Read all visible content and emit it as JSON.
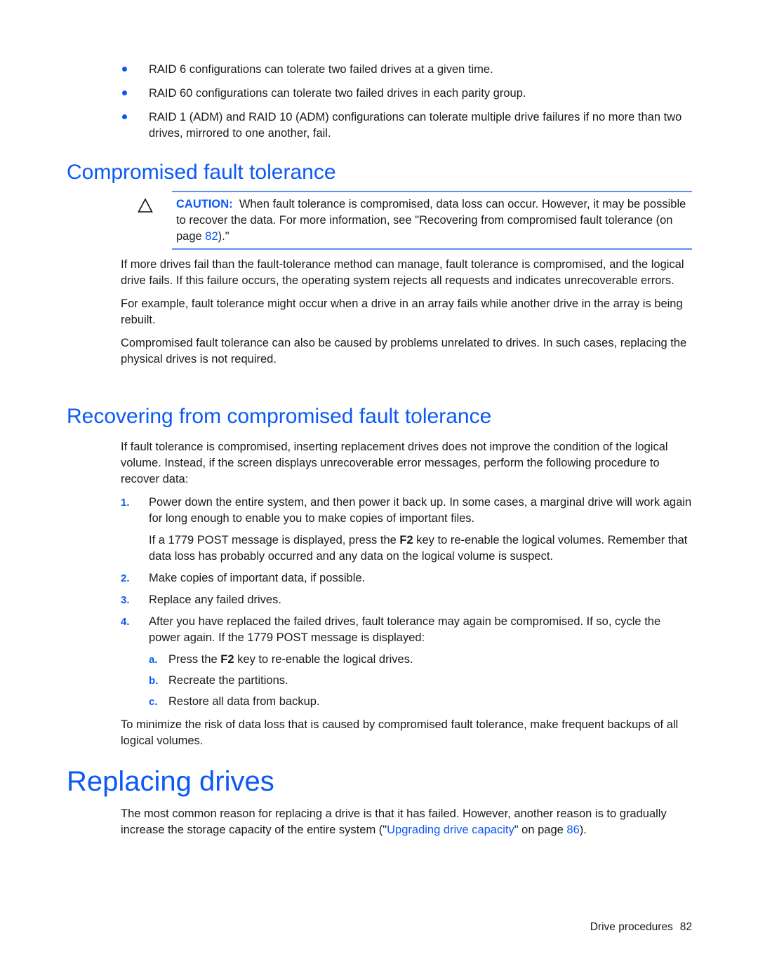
{
  "bullets": [
    "RAID 6 configurations can tolerate two failed drives at a given time.",
    "RAID 60 configurations can tolerate two failed drives in each parity group.",
    "RAID 1 (ADM) and RAID 10 (ADM) configurations can tolerate multiple drive failures if no more than two drives, mirrored to one another, fail."
  ],
  "section1": {
    "heading": "Compromised fault tolerance",
    "caution": {
      "icon": "caution-triangle-icon",
      "label": "CAUTION:",
      "text_before": "When fault tolerance is compromised, data loss can occur. However, it may be possible to recover the data. For more information, see \"Recovering from compromised fault tolerance (on page ",
      "page_link": "82",
      "text_after": ").\""
    },
    "paragraphs": [
      "If more drives fail than the fault-tolerance method can manage, fault tolerance is compromised, and the logical drive fails. If this failure occurs, the operating system rejects all requests and indicates unrecoverable errors.",
      "For example, fault tolerance might occur when a drive in an array fails while another drive in the array is being rebuilt.",
      "Compromised fault tolerance can also be caused by problems unrelated to drives. In such cases, replacing the physical drives is not required."
    ]
  },
  "section2": {
    "heading": "Recovering from compromised fault tolerance",
    "intro": "If fault tolerance is compromised, inserting replacement drives does not improve the condition of the logical volume. Instead, if the screen displays unrecoverable error messages, perform the following procedure to recover data:",
    "steps": [
      {
        "num": "1.",
        "text": "Power down the entire system, and then power it back up. In some cases, a marginal drive will work again for long enough to enable you to make copies of important files.",
        "note_before": "If a 1779 POST message is displayed, press the ",
        "note_key": "F2",
        "note_after": " key to re-enable the logical volumes. Remember that data loss has probably occurred and any data on the logical volume is suspect."
      },
      {
        "num": "2.",
        "text": "Make copies of important data, if possible."
      },
      {
        "num": "3.",
        "text": "Replace any failed drives."
      },
      {
        "num": "4.",
        "text": "After you have replaced the failed drives, fault tolerance may again be compromised. If so, cycle the power again. If the 1779 POST message is displayed:",
        "substeps": [
          {
            "num": "a.",
            "before": "Press the ",
            "key": "F2",
            "after": " key to re-enable the logical drives."
          },
          {
            "num": "b.",
            "before": "Recreate the partitions.",
            "key": "",
            "after": ""
          },
          {
            "num": "c.",
            "before": "Restore all data from backup.",
            "key": "",
            "after": ""
          }
        ]
      }
    ],
    "closing": "To minimize the risk of data loss that is caused by compromised fault tolerance, make frequent backups of all logical volumes."
  },
  "section3": {
    "heading": "Replacing drives",
    "text_before": "The most common reason for replacing a drive is that it has failed. However, another reason is to gradually increase the storage capacity of the entire system (\"",
    "link_text": "Upgrading drive capacity",
    "text_middle": "\" on page ",
    "page_link": "86",
    "text_after": ")."
  },
  "footer": {
    "section": "Drive procedures",
    "page": "82"
  }
}
